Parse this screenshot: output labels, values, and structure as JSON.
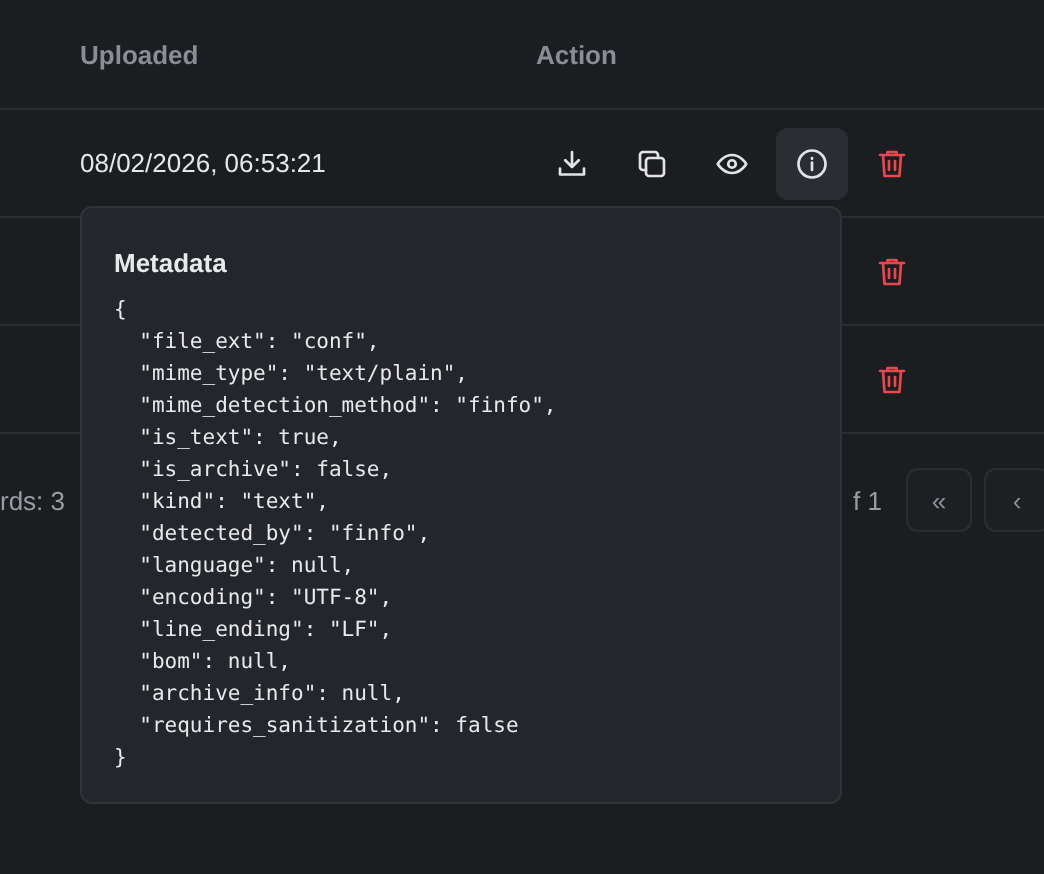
{
  "table": {
    "columns": [
      "Uploaded",
      "Action"
    ],
    "rows": [
      {
        "uploaded": "08/02/2026, 06:53:21",
        "actions": [
          {
            "kind": "download",
            "active": false
          },
          {
            "kind": "copy",
            "active": false
          },
          {
            "kind": "view",
            "active": false
          },
          {
            "kind": "info",
            "active": true
          },
          {
            "kind": "delete",
            "active": false
          }
        ]
      },
      {
        "actions": [
          {
            "kind": "delete",
            "active": false
          }
        ]
      },
      {
        "actions": [
          {
            "kind": "delete",
            "active": false
          }
        ]
      }
    ]
  },
  "footer": {
    "records": "rds: 3",
    "page": "f 1",
    "buttons": [
      "«",
      "‹"
    ]
  },
  "metadata_popover": {
    "title": "Metadata",
    "lines": [
      "{",
      "  \"file_ext\": \"conf\",",
      "  \"mime_type\": \"text/plain\",",
      "  \"mime_detection_method\": \"finfo\",",
      "  \"is_text\": true,",
      "  \"is_archive\": false,",
      "  \"kind\": \"text\",",
      "  \"detected_by\": \"finfo\",",
      "  \"language\": null,",
      "  \"encoding\": \"UTF-8\",",
      "  \"line_ending\": \"LF\",",
      "  \"bom\": null,",
      "  \"archive_info\": null,",
      "  \"requires_sanitization\": false",
      "}"
    ]
  }
}
